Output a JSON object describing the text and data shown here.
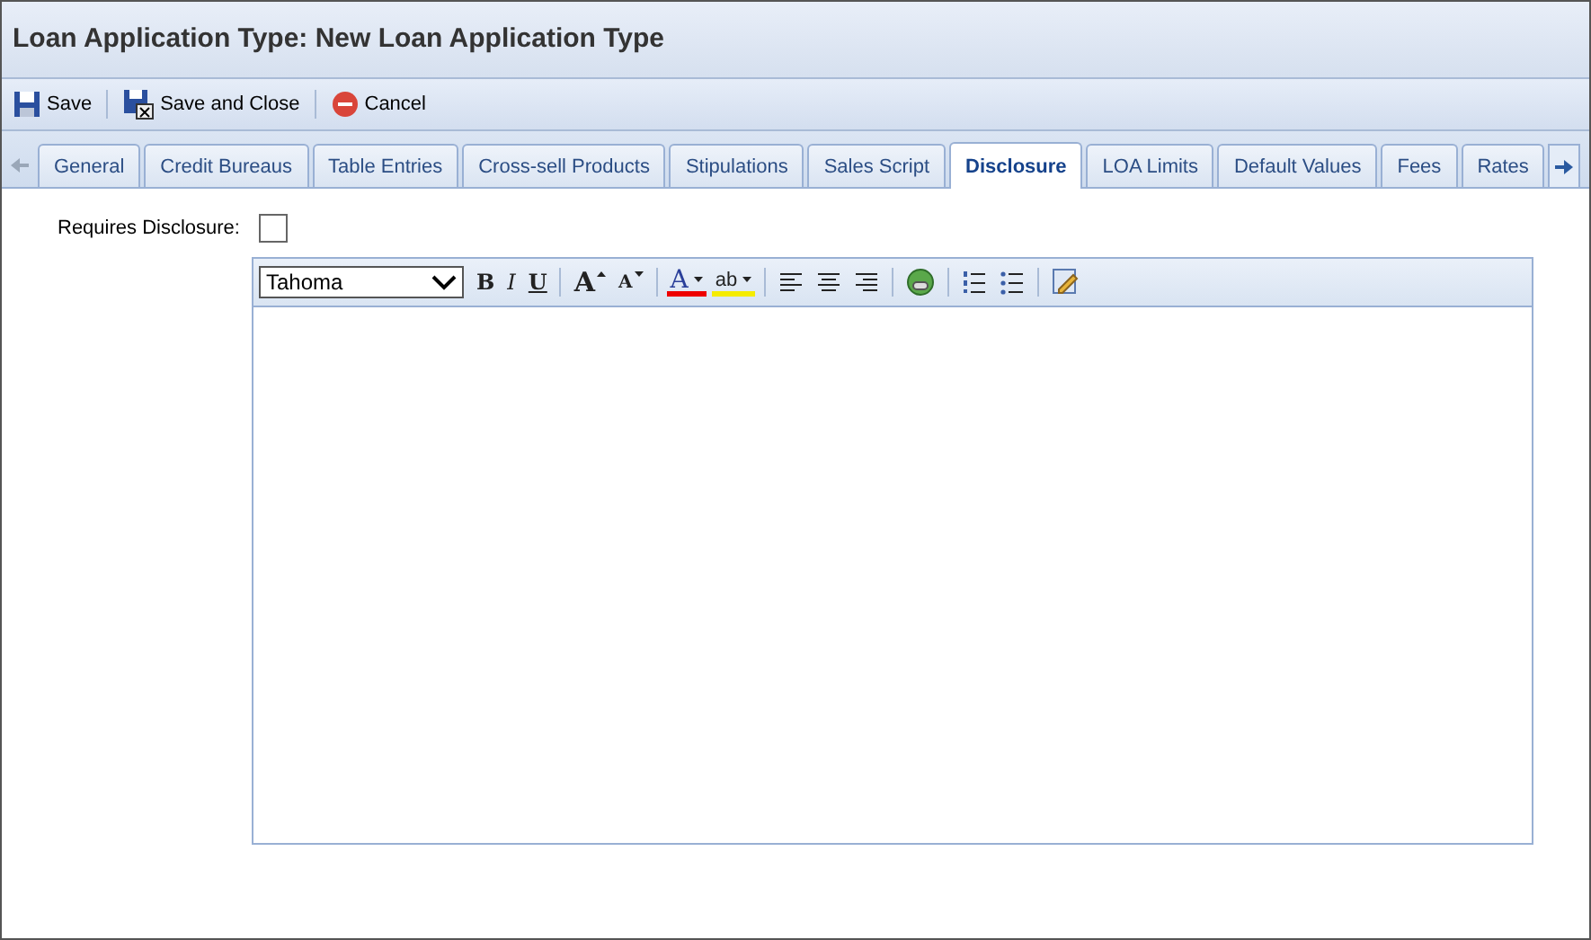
{
  "window": {
    "title": "Loan Application Type: New Loan Application Type"
  },
  "toolbar": [
    {
      "kind": "save",
      "label": "Save"
    },
    {
      "kind": "save-close",
      "label": "Save and Close"
    },
    {
      "kind": "cancel",
      "label": "Cancel"
    }
  ],
  "tabs": [
    {
      "label": "General",
      "selected": false
    },
    {
      "label": "Credit Bureaus",
      "selected": false
    },
    {
      "label": "Table Entries",
      "selected": false
    },
    {
      "label": "Cross-sell Products",
      "selected": false
    },
    {
      "label": "Stipulations",
      "selected": false
    },
    {
      "label": "Sales Script",
      "selected": false
    },
    {
      "label": "Disclosure",
      "selected": true
    },
    {
      "label": "LOA Limits",
      "selected": false
    },
    {
      "label": "Default Values",
      "selected": false
    },
    {
      "label": "Fees",
      "selected": false
    },
    {
      "label": "Rates",
      "selected": false
    }
  ],
  "requires_disclosure": {
    "label": "Requires Disclosure:",
    "checked": false
  },
  "editor": {
    "font": "Tahoma",
    "buttons": [
      {
        "kind": "bold",
        "label": "B"
      },
      {
        "kind": "italic",
        "label": "I"
      },
      {
        "kind": "underline",
        "label": "U"
      },
      {
        "kind": "sep"
      },
      {
        "kind": "grow",
        "label": "A"
      },
      {
        "kind": "shrink",
        "label": "A"
      },
      {
        "kind": "sep"
      },
      {
        "kind": "fontcolor",
        "label": "A"
      },
      {
        "kind": "highlight",
        "label": "ab"
      },
      {
        "kind": "sep"
      },
      {
        "kind": "left"
      },
      {
        "kind": "center"
      },
      {
        "kind": "right"
      },
      {
        "kind": "sep"
      },
      {
        "kind": "link"
      },
      {
        "kind": "sep"
      },
      {
        "kind": "ol"
      },
      {
        "kind": "ul"
      },
      {
        "kind": "sep"
      },
      {
        "kind": "source"
      }
    ]
  }
}
